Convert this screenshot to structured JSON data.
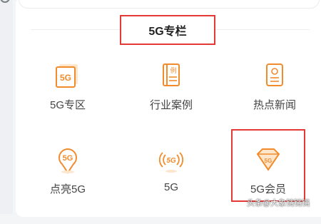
{
  "section": {
    "title": "5G专栏"
  },
  "tiles": [
    {
      "label": "5G专区",
      "icon": "5g-zone-icon"
    },
    {
      "label": "行业案例",
      "icon": "case-book-icon"
    },
    {
      "label": "热点新闻",
      "icon": "news-doc-icon"
    },
    {
      "label": "点亮5G",
      "icon": "5g-pin-icon"
    },
    {
      "label": "5G",
      "icon": "5g-signal-icon"
    },
    {
      "label": "5G会员",
      "icon": "diamond-icon"
    }
  ],
  "icon_text": {
    "zone": "5G",
    "book": "例",
    "pin": "5G",
    "signal": "5G",
    "diamond": "5G"
  },
  "watermark": "头条@大象铛铛铛",
  "colors": {
    "accent": "#f28b2c",
    "highlight": "#e53935"
  }
}
